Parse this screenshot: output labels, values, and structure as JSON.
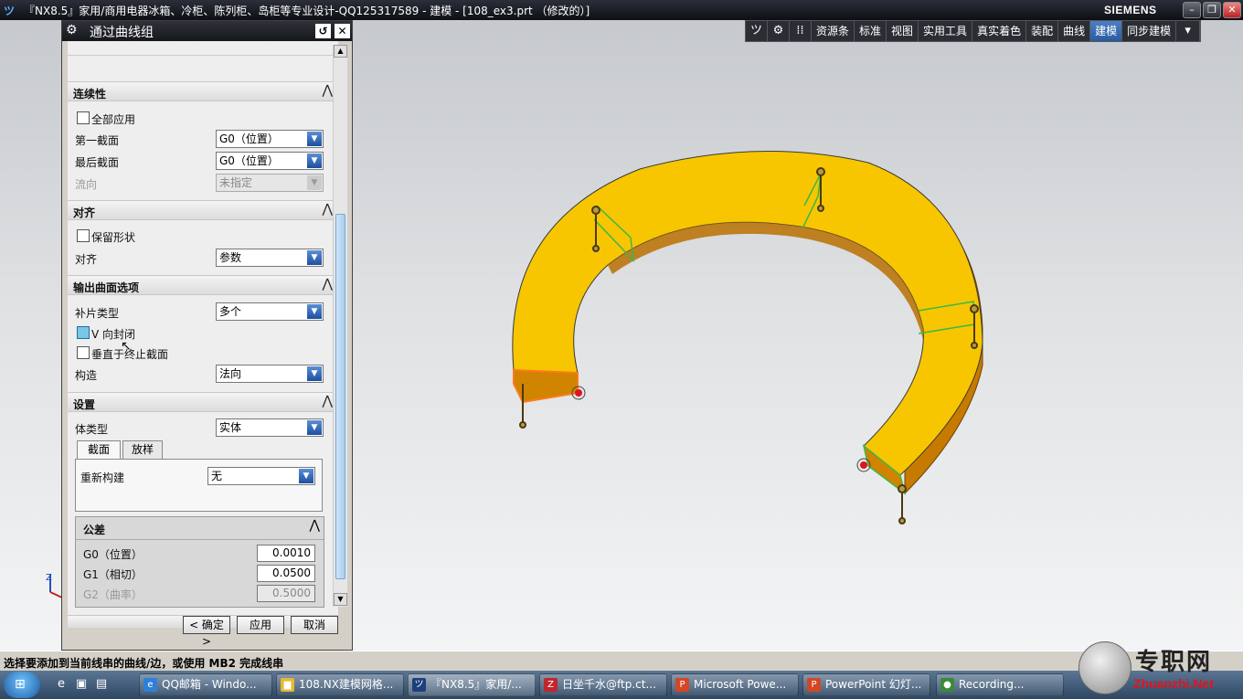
{
  "window": {
    "title": "『NX8.5』家用/商用电器冰箱、冷柜、陈列柜、岛柜等专业设计-QQ125317589 - 建模 - [108_ex3.prt （修改的）]",
    "brand": "SIEMENS",
    "app_icon": "nx-logo",
    "controls": [
      "minimize",
      "restore",
      "close"
    ]
  },
  "toolbar": {
    "icons": [
      "nx-logo-icon",
      "gear-icon",
      "grid-icon"
    ],
    "items": [
      {
        "label": "资源条",
        "active": false
      },
      {
        "label": "标准",
        "active": false
      },
      {
        "label": "视图",
        "active": false
      },
      {
        "label": "实用工具",
        "active": false
      },
      {
        "label": "真实着色",
        "active": false
      },
      {
        "label": "装配",
        "active": false
      },
      {
        "label": "曲线",
        "active": false
      },
      {
        "label": "建模",
        "active": true
      },
      {
        "label": "同步建模",
        "active": false
      }
    ]
  },
  "dialog": {
    "title": "通过曲线组",
    "continuity": {
      "header": "连续性",
      "apply_all_label": "全部应用",
      "first_section_label": "第一截面",
      "first_section_value": "G0（位置）",
      "last_section_label": "最后截面",
      "last_section_value": "G0（位置）",
      "flow_label": "流向",
      "flow_value": "未指定"
    },
    "alignment": {
      "header": "对齐",
      "keep_shape_label": "保留形状",
      "align_label": "对齐",
      "align_value": "参数"
    },
    "output": {
      "header": "输出曲面选项",
      "patch_label": "补片类型",
      "patch_value": "多个",
      "v_closed_label": "V 向封闭",
      "perp_label": "垂直于终止截面",
      "construct_label": "构造",
      "construct_value": "法向"
    },
    "settings": {
      "header": "设置",
      "body_type_label": "体类型",
      "body_type_value": "实体",
      "tab_section": "截面",
      "tab_spline": "放样",
      "rebuild_label": "重新构建",
      "rebuild_value": "无"
    },
    "tolerance": {
      "header": "公差",
      "g0_label": "G0（位置）",
      "g0_value": "0.0010",
      "g1_label": "G1（相切）",
      "g1_value": "0.0500",
      "g2_label": "G2（曲率）",
      "g2_value": "0.5000"
    },
    "buttons": {
      "ok": "< 确定 >",
      "apply": "应用",
      "cancel": "取消"
    }
  },
  "status": {
    "prompt": "选择要添加到当前线串的曲线/边，或使用 MB2 完成线串"
  },
  "taskbar": {
    "tasks": [
      {
        "label": "QQ邮箱 - Windo...",
        "icon": "browser-icon"
      },
      {
        "label": "108.NX建模网格...",
        "icon": "folder-icon"
      },
      {
        "label": "『NX8.5』家用/...",
        "icon": "nx-icon"
      },
      {
        "label": "日坐千水@ftp.ct...",
        "icon": "filezilla-icon"
      },
      {
        "label": "Microsoft Powe...",
        "icon": "powerpoint-icon"
      },
      {
        "label": "PowerPoint 幻灯...",
        "icon": "powerpoint-icon"
      },
      {
        "label": "Recording...",
        "icon": "recording-icon"
      }
    ]
  },
  "watermark": {
    "text": "专职网",
    "url": "Zhuanzhi.Net"
  },
  "colors": {
    "part_yellow": "#f7c600",
    "part_side": "#c67a00",
    "section_green": "#3bb84a",
    "selected_orange": "#ff7a1a",
    "accent_blue": "#2a5aa0"
  }
}
